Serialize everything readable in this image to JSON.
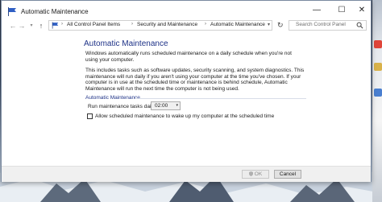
{
  "window": {
    "title": "Automatic Maintenance",
    "controls": {
      "minimize": "—",
      "maximize": "☐",
      "close": "✕"
    }
  },
  "navigation": {
    "back_glyph": "←",
    "forward_glyph": "→",
    "recent_glyph": "▾",
    "up_glyph": "↑",
    "breadcrumbs": [
      "All Control Panel Items",
      "Security and Maintenance",
      "Automatic Maintenance"
    ],
    "separator": "›",
    "dropdown_glyph": "▾",
    "refresh_glyph": "↻",
    "search_placeholder": "Search Control Panel"
  },
  "main": {
    "title": "Automatic Maintenance",
    "paragraph1": "Windows automatically runs scheduled maintenance on a daily schedule when you're not using your computer.",
    "paragraph2": "This includes tasks such as software updates, security scanning, and system diagnostics. This maintenance will run daily if you aren't using your computer at the time you've chosen. If your computer is in use at the scheduled time or maintenance is behind schedule, Automatic Maintenance will run the next time the computer is not being used.",
    "section_label": "Automatic Maintenance",
    "run_label": "Run maintenance tasks daily at",
    "time_value": "02:00",
    "time_caret": "▾",
    "wake_label": "Allow scheduled maintenance to wake up my computer at the scheduled time",
    "wake_checked": false
  },
  "footer": {
    "ok_label": "OK",
    "cancel_label": "Cancel",
    "ok_enabled": false
  },
  "colors": {
    "title_blue": "#1e3287",
    "window_bg": "#ffffff",
    "footer_bg": "#f0f0f0"
  },
  "icons": {
    "title": "maintenance-flag-icon",
    "address": "maintenance-flag-icon",
    "search": "search-icon",
    "ok_shield": "uac-shield-icon"
  }
}
